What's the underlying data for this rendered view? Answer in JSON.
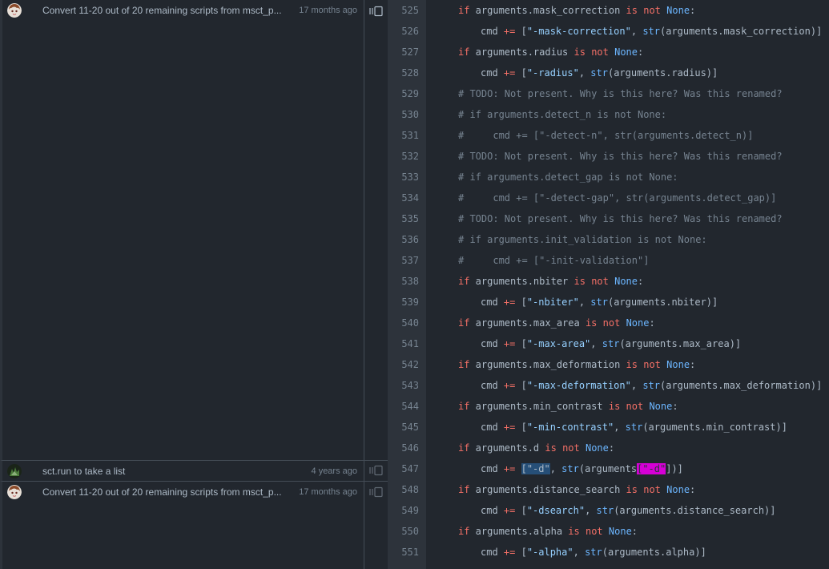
{
  "blame": {
    "hunks": [
      {
        "message": "Convert 11-20 out of 20 remaining scripts from msct_p...",
        "time": "17 months ago",
        "avatar": "anime-avatar"
      },
      {
        "message": "sct.run to take a list",
        "time": "4 years ago",
        "avatar": "tree-avatar"
      },
      {
        "message": "Convert 11-20 out of 20 remaining scripts from msct_p...",
        "time": "17 months ago",
        "avatar": "anime-avatar"
      }
    ]
  },
  "code": {
    "lines": [
      {
        "n": "525",
        "indent": 1,
        "tokens": [
          [
            "kw",
            "if"
          ],
          [
            "p",
            " arguments.mask_correction "
          ],
          [
            "kw",
            "is"
          ],
          [
            "p",
            " "
          ],
          [
            "kw",
            "not"
          ],
          [
            "p",
            " "
          ],
          [
            "bi",
            "None"
          ],
          [
            "p",
            ":"
          ]
        ]
      },
      {
        "n": "526",
        "indent": 2,
        "tokens": [
          [
            "p",
            "cmd "
          ],
          [
            "kw",
            "+="
          ],
          [
            "p",
            " ["
          ],
          [
            "str",
            "\"-mask-correction\""
          ],
          [
            "p",
            ", "
          ],
          [
            "bi",
            "str"
          ],
          [
            "p",
            "(arguments.mask_correction)]"
          ]
        ]
      },
      {
        "n": "527",
        "indent": 1,
        "tokens": [
          [
            "kw",
            "if"
          ],
          [
            "p",
            " arguments.radius "
          ],
          [
            "kw",
            "is"
          ],
          [
            "p",
            " "
          ],
          [
            "kw",
            "not"
          ],
          [
            "p",
            " "
          ],
          [
            "bi",
            "None"
          ],
          [
            "p",
            ":"
          ]
        ]
      },
      {
        "n": "528",
        "indent": 2,
        "tokens": [
          [
            "p",
            "cmd "
          ],
          [
            "kw",
            "+="
          ],
          [
            "p",
            " ["
          ],
          [
            "str",
            "\"-radius\""
          ],
          [
            "p",
            ", "
          ],
          [
            "bi",
            "str"
          ],
          [
            "p",
            "(arguments.radius)]"
          ]
        ]
      },
      {
        "n": "529",
        "indent": 1,
        "tokens": [
          [
            "cm",
            "# TODO: Not present. Why is this here? Was this renamed?"
          ]
        ]
      },
      {
        "n": "530",
        "indent": 1,
        "tokens": [
          [
            "cm",
            "# if arguments.detect_n is not None:"
          ]
        ]
      },
      {
        "n": "531",
        "indent": 1,
        "tokens": [
          [
            "cm",
            "#     cmd += [\"-detect-n\", str(arguments.detect_n)]"
          ]
        ]
      },
      {
        "n": "532",
        "indent": 1,
        "tokens": [
          [
            "cm",
            "# TODO: Not present. Why is this here? Was this renamed?"
          ]
        ]
      },
      {
        "n": "533",
        "indent": 1,
        "tokens": [
          [
            "cm",
            "# if arguments.detect_gap is not None:"
          ]
        ]
      },
      {
        "n": "534",
        "indent": 1,
        "tokens": [
          [
            "cm",
            "#     cmd += [\"-detect-gap\", str(arguments.detect_gap)]"
          ]
        ]
      },
      {
        "n": "535",
        "indent": 1,
        "tokens": [
          [
            "cm",
            "# TODO: Not present. Why is this here? Was this renamed?"
          ]
        ]
      },
      {
        "n": "536",
        "indent": 1,
        "tokens": [
          [
            "cm",
            "# if arguments.init_validation is not None:"
          ]
        ]
      },
      {
        "n": "537",
        "indent": 1,
        "tokens": [
          [
            "cm",
            "#     cmd += [\"-init-validation\"]"
          ]
        ]
      },
      {
        "n": "538",
        "indent": 1,
        "tokens": [
          [
            "kw",
            "if"
          ],
          [
            "p",
            " arguments.nbiter "
          ],
          [
            "kw",
            "is"
          ],
          [
            "p",
            " "
          ],
          [
            "kw",
            "not"
          ],
          [
            "p",
            " "
          ],
          [
            "bi",
            "None"
          ],
          [
            "p",
            ":"
          ]
        ]
      },
      {
        "n": "539",
        "indent": 2,
        "tokens": [
          [
            "p",
            "cmd "
          ],
          [
            "kw",
            "+="
          ],
          [
            "p",
            " ["
          ],
          [
            "str",
            "\"-nbiter\""
          ],
          [
            "p",
            ", "
          ],
          [
            "bi",
            "str"
          ],
          [
            "p",
            "(arguments.nbiter)]"
          ]
        ]
      },
      {
        "n": "540",
        "indent": 1,
        "tokens": [
          [
            "kw",
            "if"
          ],
          [
            "p",
            " arguments.max_area "
          ],
          [
            "kw",
            "is"
          ],
          [
            "p",
            " "
          ],
          [
            "kw",
            "not"
          ],
          [
            "p",
            " "
          ],
          [
            "bi",
            "None"
          ],
          [
            "p",
            ":"
          ]
        ]
      },
      {
        "n": "541",
        "indent": 2,
        "tokens": [
          [
            "p",
            "cmd "
          ],
          [
            "kw",
            "+="
          ],
          [
            "p",
            " ["
          ],
          [
            "str",
            "\"-max-area\""
          ],
          [
            "p",
            ", "
          ],
          [
            "bi",
            "str"
          ],
          [
            "p",
            "(arguments.max_area)]"
          ]
        ]
      },
      {
        "n": "542",
        "indent": 1,
        "tokens": [
          [
            "kw",
            "if"
          ],
          [
            "p",
            " arguments.max_deformation "
          ],
          [
            "kw",
            "is"
          ],
          [
            "p",
            " "
          ],
          [
            "kw",
            "not"
          ],
          [
            "p",
            " "
          ],
          [
            "bi",
            "None"
          ],
          [
            "p",
            ":"
          ]
        ]
      },
      {
        "n": "543",
        "indent": 2,
        "tokens": [
          [
            "p",
            "cmd "
          ],
          [
            "kw",
            "+="
          ],
          [
            "p",
            " ["
          ],
          [
            "str",
            "\"-max-deformation\""
          ],
          [
            "p",
            ", "
          ],
          [
            "bi",
            "str"
          ],
          [
            "p",
            "(arguments.max_deformation)]"
          ]
        ]
      },
      {
        "n": "544",
        "indent": 1,
        "tokens": [
          [
            "kw",
            "if"
          ],
          [
            "p",
            " arguments.min_contrast "
          ],
          [
            "kw",
            "is"
          ],
          [
            "p",
            " "
          ],
          [
            "kw",
            "not"
          ],
          [
            "p",
            " "
          ],
          [
            "bi",
            "None"
          ],
          [
            "p",
            ":"
          ]
        ]
      },
      {
        "n": "545",
        "indent": 2,
        "tokens": [
          [
            "p",
            "cmd "
          ],
          [
            "kw",
            "+="
          ],
          [
            "p",
            " ["
          ],
          [
            "str",
            "\"-min-contrast\""
          ],
          [
            "p",
            ", "
          ],
          [
            "bi",
            "str"
          ],
          [
            "p",
            "(arguments.min_contrast)]"
          ]
        ]
      },
      {
        "n": "546",
        "indent": 1,
        "tokens": [
          [
            "kw",
            "if"
          ],
          [
            "p",
            " arguments.d "
          ],
          [
            "kw",
            "is"
          ],
          [
            "p",
            " "
          ],
          [
            "kw",
            "not"
          ],
          [
            "p",
            " "
          ],
          [
            "bi",
            "None"
          ],
          [
            "p",
            ":"
          ]
        ]
      },
      {
        "n": "547",
        "indent": 2,
        "tokens": [
          [
            "p",
            "cmd "
          ],
          [
            "kw",
            "+="
          ],
          [
            "p",
            " "
          ],
          [
            "sel",
            "[\"-d\""
          ],
          [
            "p",
            ", "
          ],
          [
            "bi",
            "str"
          ],
          [
            "p",
            "(arguments"
          ],
          [
            "mag",
            "[\"-d\""
          ],
          [
            "p",
            "])]"
          ]
        ]
      },
      {
        "n": "548",
        "indent": 1,
        "tokens": [
          [
            "kw",
            "if"
          ],
          [
            "p",
            " arguments.distance_search "
          ],
          [
            "kw",
            "is"
          ],
          [
            "p",
            " "
          ],
          [
            "kw",
            "not"
          ],
          [
            "p",
            " "
          ],
          [
            "bi",
            "None"
          ],
          [
            "p",
            ":"
          ]
        ]
      },
      {
        "n": "549",
        "indent": 2,
        "tokens": [
          [
            "p",
            "cmd "
          ],
          [
            "kw",
            "+="
          ],
          [
            "p",
            " ["
          ],
          [
            "str",
            "\"-dsearch\""
          ],
          [
            "p",
            ", "
          ],
          [
            "bi",
            "str"
          ],
          [
            "p",
            "(arguments.distance_search)]"
          ]
        ]
      },
      {
        "n": "550",
        "indent": 1,
        "tokens": [
          [
            "kw",
            "if"
          ],
          [
            "p",
            " arguments.alpha "
          ],
          [
            "kw",
            "is"
          ],
          [
            "p",
            " "
          ],
          [
            "kw",
            "not"
          ],
          [
            "p",
            " "
          ],
          [
            "bi",
            "None"
          ],
          [
            "p",
            ":"
          ]
        ]
      },
      {
        "n": "551",
        "indent": 2,
        "tokens": [
          [
            "p",
            "cmd "
          ],
          [
            "kw",
            "+="
          ],
          [
            "p",
            " ["
          ],
          [
            "str",
            "\"-alpha\""
          ],
          [
            "p",
            ", "
          ],
          [
            "bi",
            "str"
          ],
          [
            "p",
            "(arguments.alpha)]"
          ]
        ]
      }
    ]
  },
  "colors": {
    "background": "#22272e",
    "gutter": "#2d333b",
    "keyword": "#f47067",
    "string": "#96d0ff",
    "builtin": "#6cb6ff",
    "comment": "#768390",
    "selection": "#264f78",
    "match": "#d600d6"
  }
}
